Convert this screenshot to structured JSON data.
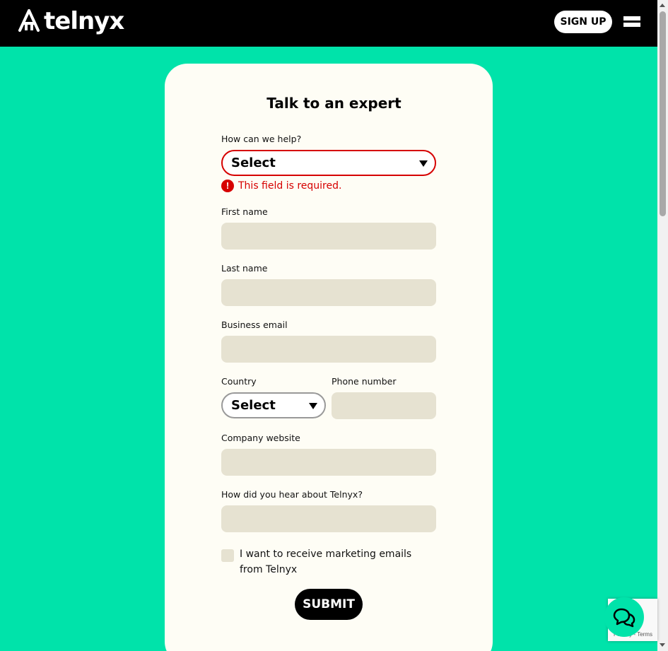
{
  "header": {
    "logo_text": "telnyx",
    "signup_label": "SIGN UP"
  },
  "form": {
    "title": "Talk to an expert",
    "help": {
      "label": "How can we help?",
      "value": "Select",
      "error": "This field is required."
    },
    "first_name": {
      "label": "First name",
      "value": ""
    },
    "last_name": {
      "label": "Last name",
      "value": ""
    },
    "business_email": {
      "label": "Business email",
      "value": ""
    },
    "country": {
      "label": "Country",
      "value": "Select"
    },
    "phone": {
      "label": "Phone number",
      "value": ""
    },
    "company_website": {
      "label": "Company website",
      "value": ""
    },
    "heard_about": {
      "label": "How did you hear about Telnyx?",
      "value": ""
    },
    "marketing_checkbox": {
      "label": "I want to receive marketing emails from Telnyx",
      "checked": false
    },
    "submit_label": "SUBMIT"
  },
  "recaptcha": {
    "terms_text": "Privacy - Terms"
  },
  "colors": {
    "brand_green": "#00E3AA",
    "card_bg": "#FEFDF5",
    "input_bg": "#E6E2D1",
    "error_red": "#D60000"
  }
}
